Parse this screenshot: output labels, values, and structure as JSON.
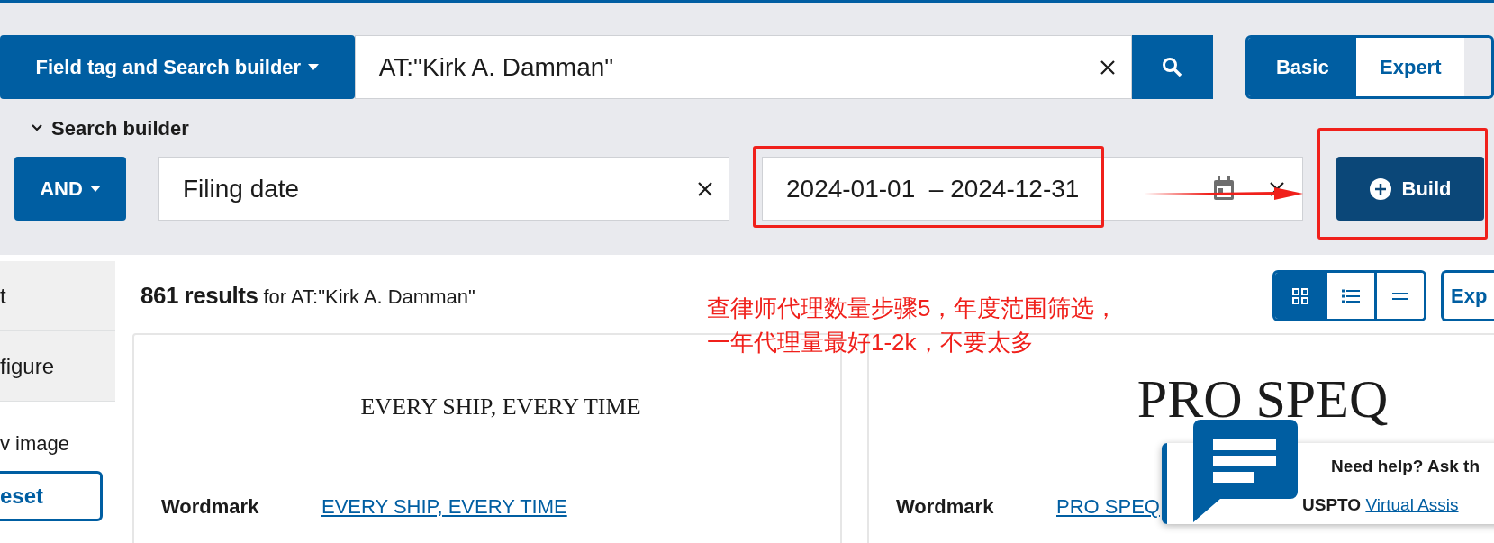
{
  "search_bar": {
    "field_menu": "Field tag and Search builder",
    "query": "AT:\"Kirk A. Damman\""
  },
  "mode_tabs": [
    {
      "label": "Basic",
      "selected": true
    },
    {
      "label": "Expert",
      "selected": false
    }
  ],
  "search_builder": {
    "toggle": "Search builder",
    "expanded": true,
    "operator": "AND",
    "field": "Filing date",
    "date_range": "2024-01-01  – 2024-12-31",
    "build_button": "Build"
  },
  "sidebar": {
    "items": [
      "t",
      "figure"
    ],
    "option_label": "v image",
    "reset_button": "eset"
  },
  "results": {
    "count": "861 results",
    "query_text": "for AT:\"Kirk A. Damman\"",
    "views": [
      {
        "kind": "grid",
        "selected": true
      },
      {
        "kind": "list",
        "selected": false
      },
      {
        "kind": "compact",
        "selected": false
      }
    ],
    "export_button": "Exp",
    "cards": [
      {
        "image_text": "EVERY SHIP, EVERY TIME",
        "label": "Wordmark",
        "value": "EVERY SHIP, EVERY TIME"
      },
      {
        "image_text": "PRO SPEQ",
        "label": "Wordmark",
        "value": "PRO SPEQ"
      }
    ]
  },
  "annotation": {
    "lines": [
      "查律师代理数量步骤5，年度范围筛选，",
      "一年代理量最好1-2k，不要太多"
    ]
  },
  "chat": {
    "title": "Need help? Ask th",
    "prefix": "USPTO",
    "link": "Virtual Assis"
  }
}
